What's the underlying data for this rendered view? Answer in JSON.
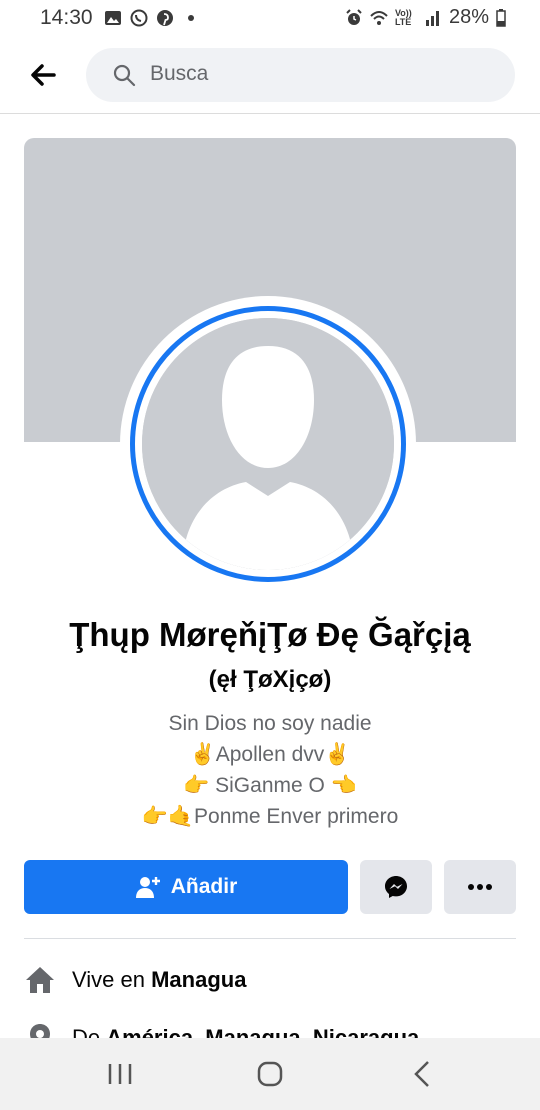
{
  "status_bar": {
    "time": "14:30",
    "battery": "28%",
    "left_icons": [
      "gallery-icon",
      "whatsapp-icon",
      "pinterest-icon",
      "dot-icon"
    ],
    "right_icons": [
      "alarm-icon",
      "wifi-icon",
      "volte-icon",
      "signal-icon",
      "battery-icon"
    ],
    "volte_text": "Vo)) LTE"
  },
  "header": {
    "search_placeholder": "Busca"
  },
  "profile": {
    "name": "Ţhųp MøręňįŢø Đę Ğąřçįą",
    "nickname": "(ęł ŢøXįçø)",
    "bio": [
      "Sin Dios no soy nadie",
      "✌️Apollen dvv✌️",
      "👉 SiGanme O 👈",
      "👉🤙Ponme Enver primero"
    ]
  },
  "actions": {
    "add_label": "Añadir"
  },
  "info": {
    "lives_prefix": "Vive en ",
    "lives_place": "Managua",
    "from_prefix": "De ",
    "from_place": "América, Managua, Nicaragua"
  },
  "colors": {
    "accent": "#1877f2",
    "cover": "#c9ccd1",
    "button_gray": "#e4e6eb",
    "text_secondary": "#65676b"
  }
}
